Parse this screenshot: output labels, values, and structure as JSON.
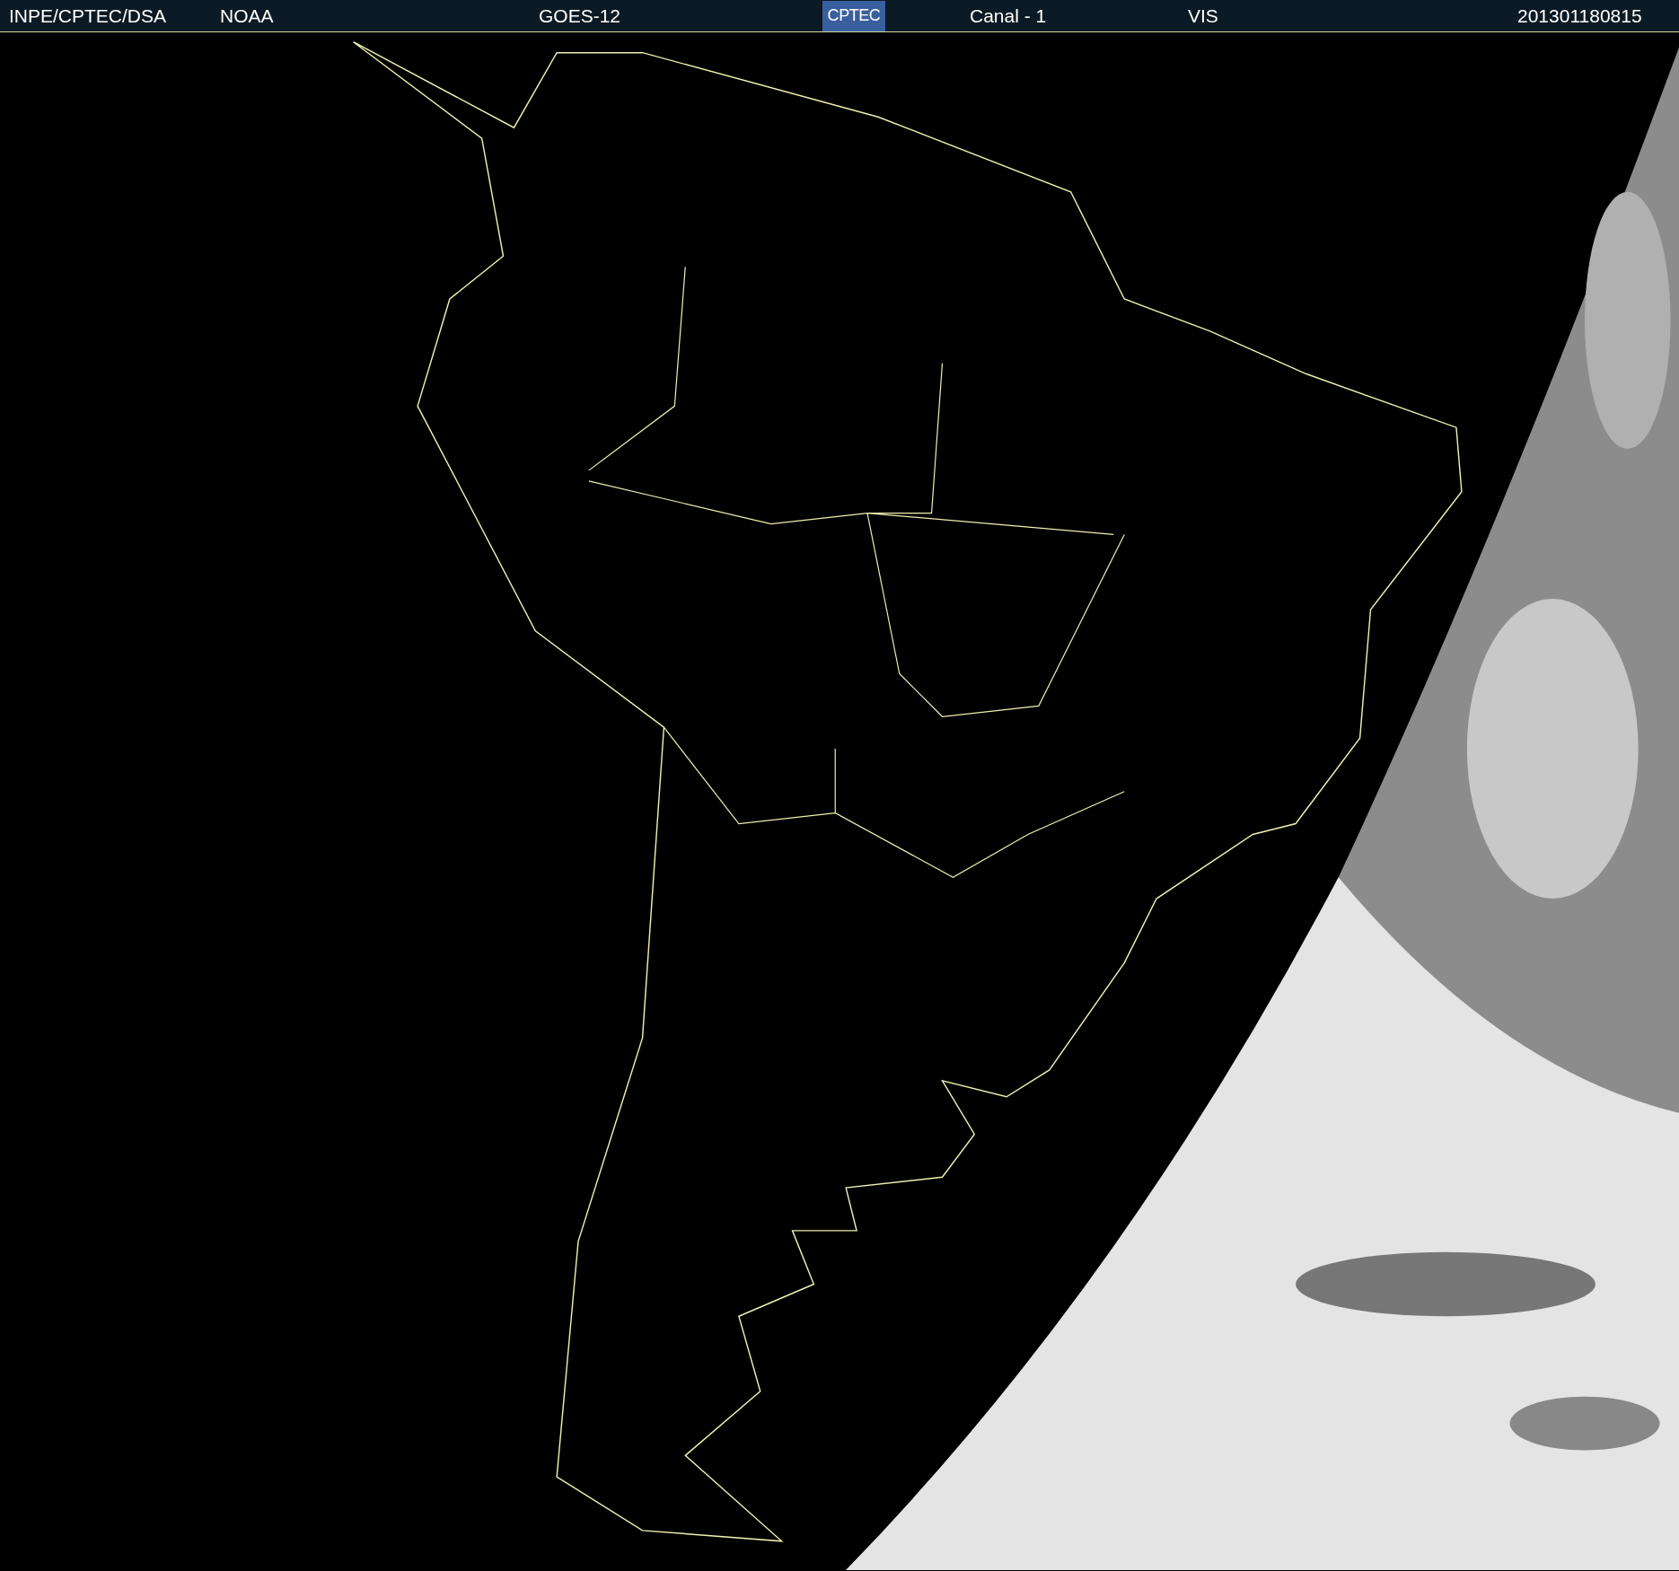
{
  "header": {
    "items": [
      {
        "kind": "text",
        "text": "INPE/CPTEC/DSA"
      },
      {
        "kind": "text",
        "text": "NOAA"
      },
      {
        "kind": "text",
        "text": "GOES-12"
      },
      {
        "kind": "logo",
        "text": "CPTEC"
      },
      {
        "kind": "text",
        "text": "Canal - 1"
      },
      {
        "kind": "text",
        "text": "VIS"
      },
      {
        "kind": "text",
        "text": "201301180815"
      }
    ]
  }
}
